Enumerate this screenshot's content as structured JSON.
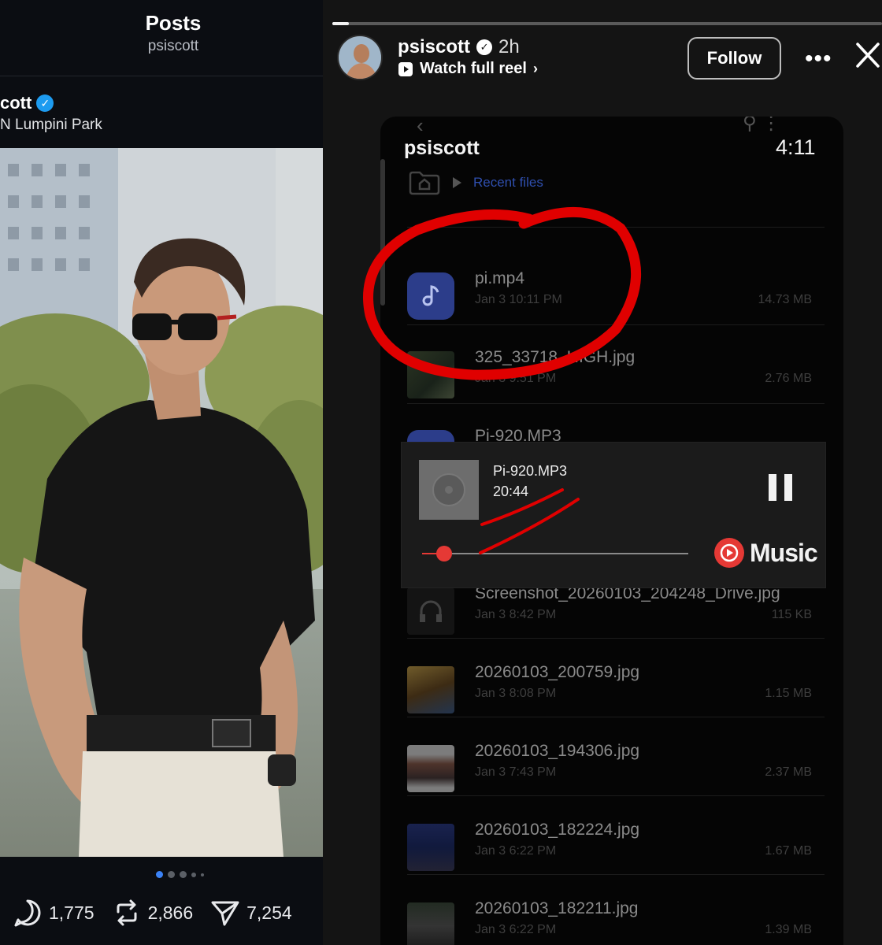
{
  "left_panel": {
    "header_title": "Posts",
    "header_subtitle": "psiscott",
    "author_name": "cott",
    "location": "N Lumpini Park",
    "actions": {
      "replies": "1,775",
      "reposts": "2,866",
      "shares": "7,254"
    },
    "carousel_dots": 5,
    "carousel_active_index": 0
  },
  "story": {
    "username": "psiscott",
    "time_ago": "2h",
    "watch_reel_label": "Watch full reel",
    "follow_label": "Follow",
    "more_label": "•••",
    "progress": 0.03
  },
  "phone": {
    "title": "psiscott",
    "clock": "4:11",
    "breadcrumb": "Recent files",
    "files": [
      {
        "name": "pi.mp4",
        "date": "Jan 3 10:11 PM",
        "size": "14.73 MB",
        "type": "audio"
      },
      {
        "name": "325_33718_HIGH.jpg",
        "date": "Jan 3 9:51 PM",
        "size": "2.76 MB",
        "type": "image"
      },
      {
        "name": "Pi-920.MP3",
        "date": "",
        "size": "",
        "type": "audio"
      },
      {
        "name": "Screenshot_20260103_204248_Drive.jpg",
        "date": "Jan 3 8:42 PM",
        "size": "115 KB",
        "type": "image"
      },
      {
        "name": "20260103_200759.jpg",
        "date": "Jan 3 8:08 PM",
        "size": "1.15 MB",
        "type": "image"
      },
      {
        "name": "20260103_194306.jpg",
        "date": "Jan 3 7:43 PM",
        "size": "2.37 MB",
        "type": "image"
      },
      {
        "name": "20260103_182224.jpg",
        "date": "Jan 3 6:22 PM",
        "size": "1.67 MB",
        "type": "image"
      },
      {
        "name": "20260103_182211.jpg",
        "date": "Jan 3 6:22 PM",
        "size": "1.39 MB",
        "type": "image"
      }
    ],
    "player": {
      "title": "Pi-920.MP3",
      "elapsed": "20:44",
      "brand": "Music",
      "progress": 0.09
    }
  },
  "colors": {
    "accent_blue": "#1d9bf0",
    "annotation_red": "#e00000",
    "music_red": "#e53935"
  }
}
